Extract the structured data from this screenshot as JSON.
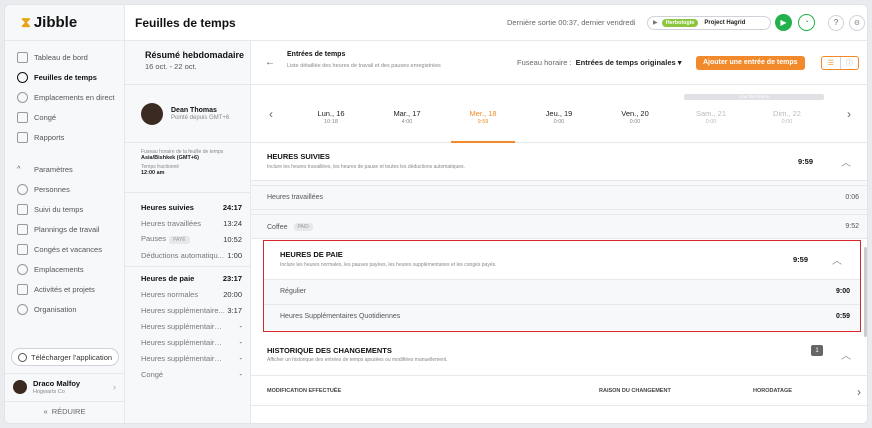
{
  "app": {
    "logo": "Jibble"
  },
  "topbar": {
    "title": "Feuilles de temps",
    "last_out": "Dernière sortie 00:37, dernier vendredi",
    "activity_tag": "Herbologie",
    "project": "Project Hagrid"
  },
  "nav": {
    "items": [
      {
        "label": "Tableau de bord",
        "active": false
      },
      {
        "label": "Feuilles de temps",
        "active": true
      },
      {
        "label": "Emplacements en direct",
        "active": false
      },
      {
        "label": "Congé",
        "active": false
      },
      {
        "label": "Rapports",
        "active": false
      }
    ],
    "settings": [
      {
        "label": "Paramètres"
      },
      {
        "label": "Personnes"
      },
      {
        "label": "Suivi du temps"
      },
      {
        "label": "Plannings de travail"
      },
      {
        "label": "Congés et vacances"
      },
      {
        "label": "Emplacements"
      },
      {
        "label": "Activités et projets"
      },
      {
        "label": "Organisation"
      }
    ],
    "download": "Télécharger l'application",
    "user_name": "Draco Malfoy",
    "user_org": "Hogwarts Co",
    "reduce": "RÉDUIRE"
  },
  "summary": {
    "title": "Résumé hebdomadaire",
    "range": "16 oct. - 22 oct.",
    "employee": "Dean Thomas",
    "employee_status": "Pointé depuis GMT+6",
    "tz_label": "Fuseau horaire de la feuille de temps",
    "tz_value": "Asia/Bishkek (GMT+6)",
    "split_label": "Temps fractionné",
    "split_value": "12:00 am",
    "tracked_label": "Heures suivies",
    "tracked_value": "24:17",
    "worked_label": "Heures travaillées",
    "worked_value": "13:24",
    "breaks_label": "Pauses",
    "breaks_pill": "PAYÉ",
    "breaks_value": "10:52",
    "auto_label": "Déductions automatiqu...",
    "auto_value": "1:00",
    "pay_label": "Heures de paie",
    "pay_value": "23:17",
    "normal_label": "Heures normales",
    "normal_value": "20:00",
    "ot1_label": "Heures supplémentaire...",
    "ot1_value": "3:17",
    "ot2_label": "Heures supplémentaires d...",
    "ot2_value": "-",
    "ot3_label": "Heures supplémentaires d...",
    "ot3_value": "-",
    "ot4_label": "Heures supplémentaires d...",
    "ot4_value": "-",
    "leave_label": "Congé",
    "leave_value": "-"
  },
  "main": {
    "title": "Entrées de temps",
    "subtitle": "Liste détaillée des heures de travail et des pauses enregistrées",
    "tz_label": "Fuseau horaire :",
    "tz_value": "Entrées de temps originales ▾",
    "add_button": "Ajouter une entrée de temps",
    "rest_day": "Jour De Repos",
    "days": [
      {
        "name": "Lun., 16",
        "hours": "10:18",
        "state": "normal"
      },
      {
        "name": "Mar., 17",
        "hours": "4:00",
        "state": "normal"
      },
      {
        "name": "Mer., 18",
        "hours": "9:59",
        "state": "selected"
      },
      {
        "name": "Jeu., 19",
        "hours": "0:00",
        "state": "normal"
      },
      {
        "name": "Ven., 20",
        "hours": "0:00",
        "state": "normal"
      },
      {
        "name": "Sam., 21",
        "hours": "0:00",
        "state": "dim"
      },
      {
        "name": "Dim., 22",
        "hours": "0:00",
        "state": "dim"
      }
    ],
    "tracked": {
      "title": "HEURES SUIVIES",
      "subtitle": "Inclure les heures travaillées, les heures de pause et toutes les déductions automatiques.",
      "total": "9:59",
      "rows": [
        {
          "label": "Heures travaillées",
          "value": "0:06"
        },
        {
          "label": "Coffee",
          "pill": "PAID",
          "value": "9:52"
        }
      ]
    },
    "payroll": {
      "title": "HEURES DE PAIE",
      "subtitle": "Inclure les heures normales, les pauses payées, les heures supplémentaires et les congés payés.",
      "total": "9:59",
      "rows": [
        {
          "label": "Régulier",
          "value": "9:00"
        },
        {
          "label": "Heures Supplémentaires Quotidiennes",
          "value": "0:59"
        }
      ]
    },
    "history": {
      "title": "HISTORIQUE DES CHANGEMENTS",
      "subtitle": "Afficher un historique des entrées de temps ajoutées ou modifiées manuellement.",
      "count": "1",
      "col_change": "MODIFICATION EFFECTUÉE",
      "col_reason": "RAISON DU CHANGEMENT",
      "col_time": "HORODATAGE"
    }
  }
}
